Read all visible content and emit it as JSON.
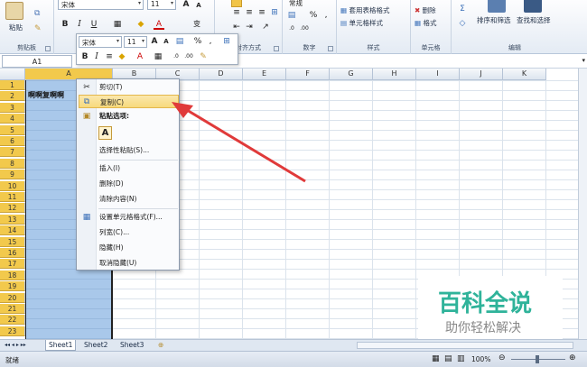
{
  "ribbon": {
    "clipboard": {
      "paste_label": "粘贴",
      "group_label": "剪贴板"
    },
    "font": {
      "name": "宋体",
      "size": "11",
      "bold": "B",
      "italic": "I",
      "underline": "U",
      "grow": "A",
      "shrink": "A",
      "color_label": "A",
      "wen": "变"
    },
    "alignment": {
      "group_label": "对齐方式"
    },
    "number": {
      "format": "常规",
      "percent": "%",
      "comma": ",",
      "group_label": "数字"
    },
    "styles": {
      "table_format": "套用表格格式",
      "cell_style": "单元格样式",
      "group_label": "样式"
    },
    "cells": {
      "delete": "删除",
      "format": "格式",
      "group_label": "单元格"
    },
    "editing": {
      "sort_filter": "排序和筛选",
      "find_select": "查找和选择",
      "sigma": "Σ",
      "group_label": "编辑"
    }
  },
  "mini_toolbar": {
    "font": "宋体",
    "size": "11",
    "percent": "%",
    "comma": ",",
    "bold": "B",
    "italic": "I"
  },
  "formula_bar": {
    "name_box": "A1"
  },
  "columns": [
    "A",
    "B",
    "C",
    "D",
    "E",
    "F",
    "G",
    "H",
    "I",
    "J",
    "K"
  ],
  "rows": [
    "1",
    "2",
    "3",
    "4",
    "5",
    "6",
    "7",
    "8",
    "9",
    "10",
    "11",
    "12",
    "13",
    "14",
    "15",
    "16",
    "17",
    "18",
    "19",
    "20",
    "21",
    "22",
    "23"
  ],
  "cells": {
    "A2": "啊啊复啊啊"
  },
  "context_menu": {
    "cut": "剪切(T)",
    "copy": "复制(C)",
    "paste_options": "粘贴选项:",
    "paste_a": "A",
    "paste_special": "选择性粘贴(S)...",
    "insert": "插入(I)",
    "delete": "删除(D)",
    "clear": "清除内容(N)",
    "format_cells": "设置单元格格式(F)...",
    "col_width": "列宽(C)...",
    "hide": "隐藏(H)",
    "unhide": "取消隐藏(U)"
  },
  "sheets": [
    "Sheet1",
    "Sheet2",
    "Sheet3"
  ],
  "status": {
    "ready": "就绪",
    "zoom": "100%"
  },
  "watermark": {
    "title": "百科全说",
    "subtitle": "助你轻松解决"
  },
  "colors": {
    "selection": "#a9c8ea",
    "highlight": "#f7d97c",
    "row_header": "#f2c94c",
    "arrow": "#e03a3a",
    "watermark": "#2fb39a"
  }
}
